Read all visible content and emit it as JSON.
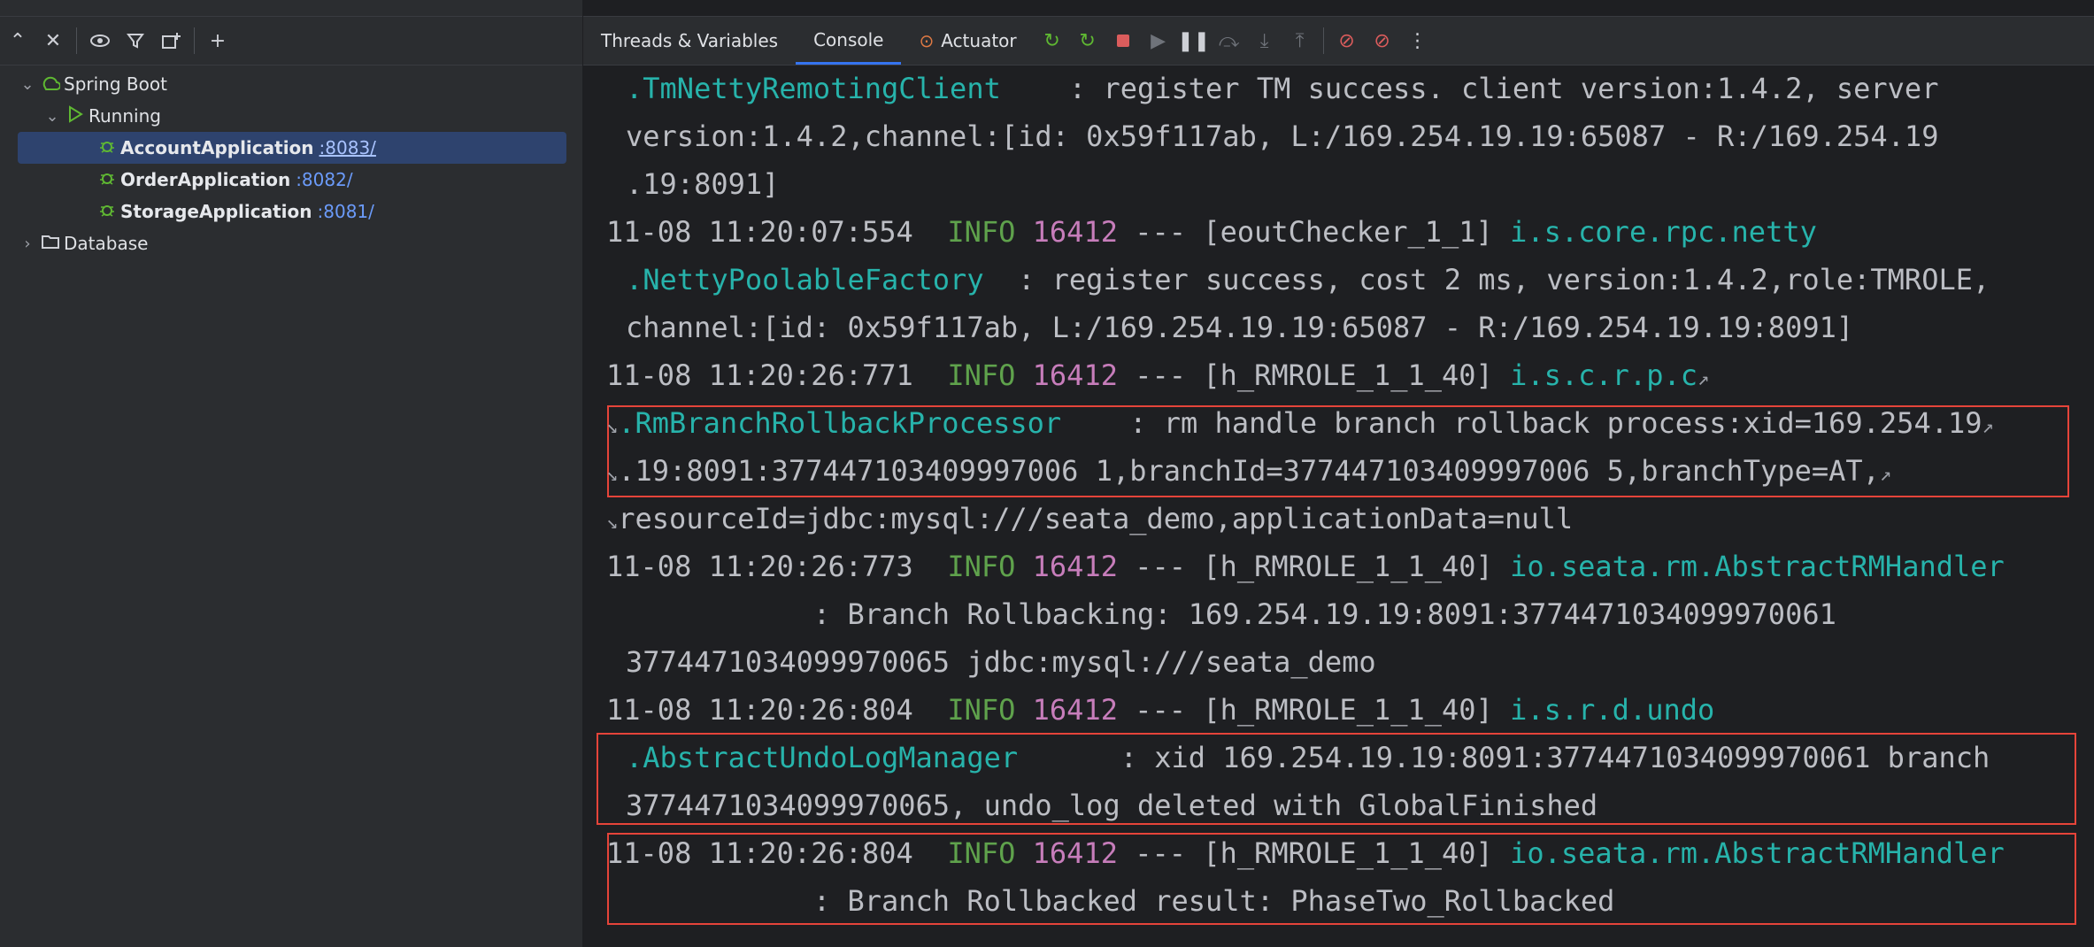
{
  "left_panel": {
    "toolbar_icons": [
      "expand-all-icon",
      "collapse-all-icon",
      "eye-icon",
      "filter-icon",
      "new-group-icon",
      "add-service-icon"
    ],
    "tree": {
      "root": "Spring Boot",
      "running": "Running",
      "apps": [
        {
          "name": "AccountApplication",
          "port": ":8083/",
          "selected": true
        },
        {
          "name": "OrderApplication",
          "port": ":8082/",
          "selected": false
        },
        {
          "name": "StorageApplication",
          "port": ":8081/",
          "selected": false
        }
      ],
      "database": "Database"
    }
  },
  "right_panel": {
    "tabs": [
      "Threads & Variables",
      "Console",
      "Actuator"
    ],
    "active_tab": "Console"
  },
  "console": {
    "lines": [
      {
        "cls": ".TmNettyRemotingClient",
        "text": "    : register TM success. client version:1.4.2, server"
      },
      {
        "text": "version:1.4.2,channel:[id: 0x59f117ab, L:/169.254.19.19:65087 - R:/169.254.19"
      },
      {
        "text": ".19:8091]"
      },
      {
        "ts": "11-08 11:20:07:554",
        "lvl": "INFO",
        "pid": "16412",
        "thread": "--- [eoutChecker_1_1]",
        "cls": "i.s.core.rpc.netty"
      },
      {
        "cls": ".NettyPoolableFactory",
        "text": "  : register success, cost 2 ms, version:1.4.2,role:TMROLE,"
      },
      {
        "text": "channel:[id: 0x59f117ab, L:/169.254.19.19:65087 - R:/169.254.19.19:8091]"
      },
      {
        "ts": "11-08 11:20:26:771",
        "lvl": "INFO",
        "pid": "16412",
        "thread": "--- [h_RMROLE_1_1_40]",
        "cls": "i.s.c.r.p.c"
      },
      {
        "cls": ".RmBranchRollbackProcessor",
        "text": "    : rm handle branch rollback process:xid=169.254.19"
      },
      {
        "text": ".19:8091:377447103409997006 1,branchId=377447103409997006 5,branchType=AT,"
      },
      {
        "text": "resourceId=jdbc:mysql:///seata_demo,applicationData=null"
      },
      {
        "ts": "11-08 11:20:26:773",
        "lvl": "INFO",
        "pid": "16412",
        "thread": "--- [h_RMROLE_1_1_40]",
        "cls": "io.seata.rm.AbstractRMHandler"
      },
      {
        "text": "           : Branch Rollbacking: 169.254.19.19:8091:3774471034099970061"
      },
      {
        "text": "3774471034099970065 jdbc:mysql:///seata_demo"
      },
      {
        "ts": "11-08 11:20:26:804",
        "lvl": "INFO",
        "pid": "16412",
        "thread": "--- [h_RMROLE_1_1_40]",
        "cls": "i.s.r.d.undo"
      },
      {
        "cls": ".AbstractUndoLogManager",
        "text": "      : xid 169.254.19.19:8091:3774471034099970061 branch"
      },
      {
        "text": "3774471034099970065, undo_log deleted with GlobalFinished"
      },
      {
        "ts": "11-08 11:20:26:804",
        "lvl": "INFO",
        "pid": "16412",
        "thread": "--- [h_RMROLE_1_1_40]",
        "cls": "io.seata.rm.AbstractRMHandler"
      },
      {
        "text": "           : Branch Rollbacked result: PhaseTwo_Rollbacked"
      }
    ]
  }
}
